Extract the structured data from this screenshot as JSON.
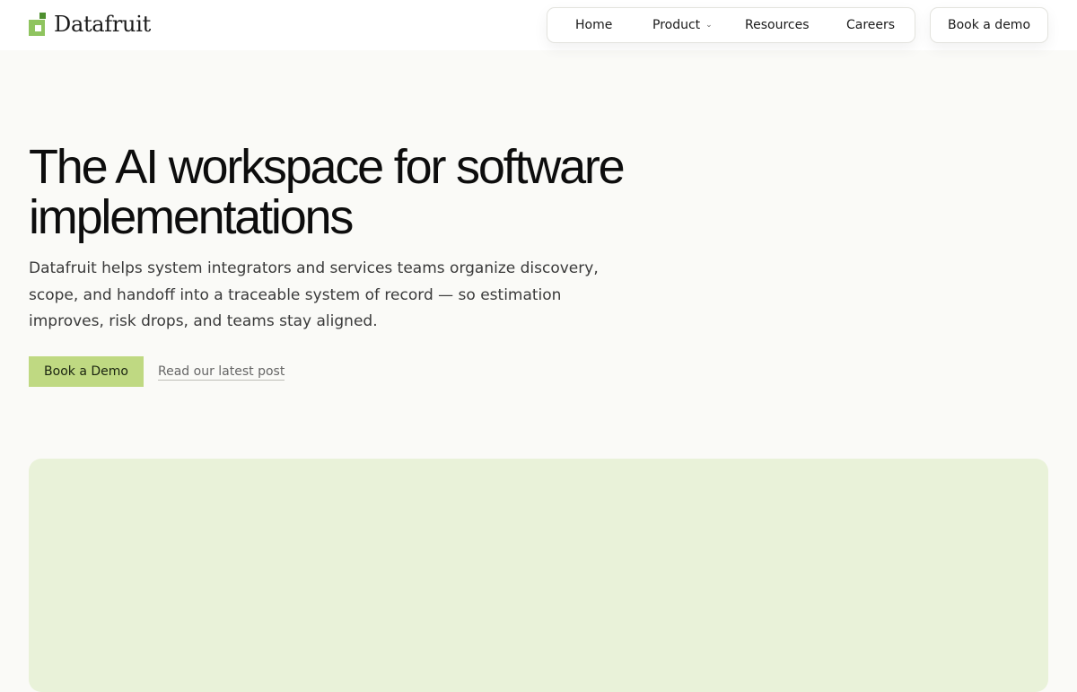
{
  "brand": {
    "name": "Datafruit",
    "logo_icon": "datafruit-logo-icon",
    "accent_color": "#8fc45f"
  },
  "nav": {
    "items": [
      {
        "label": "Home"
      },
      {
        "label": "Product",
        "icon": "chevron-down-icon"
      },
      {
        "label": "Resources"
      },
      {
        "label": "Careers"
      }
    ],
    "cta_label": "Book a demo"
  },
  "hero": {
    "title": "The AI workspace for software implementations",
    "subtitle": "Datafruit helps system integrators and services teams organize discovery, scope, and handoff into a traceable system of record — so estimation improves, risk drops, and teams stay aligned.",
    "primary_cta": "Book a Demo",
    "secondary_cta": "Read our latest post"
  },
  "panel": {
    "color": "#e9f2d9"
  }
}
